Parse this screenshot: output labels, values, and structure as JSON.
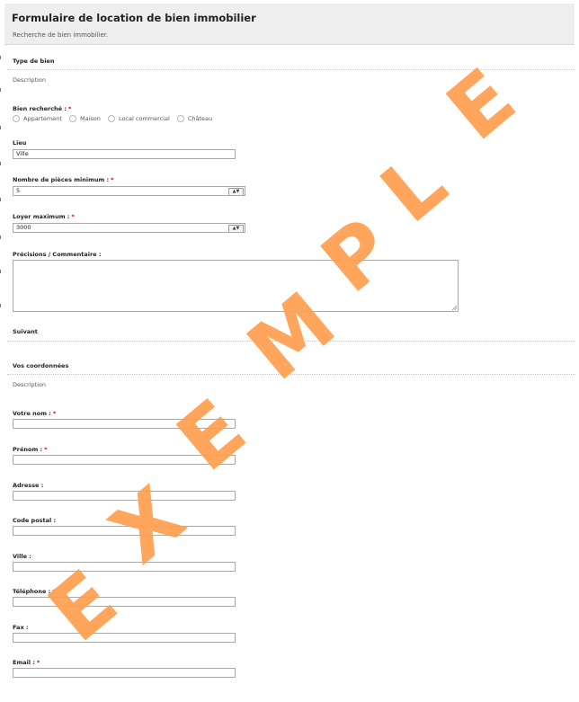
{
  "header": {
    "title": "Formulaire de location de bien immobilier",
    "subtitle": "Recherche de bien immobilier."
  },
  "section1": {
    "title": "Type de bien",
    "description": "Description",
    "bien_recherche": {
      "label": "Bien recherché :",
      "required": "*",
      "options": [
        "Appartement",
        "Maison",
        "Local commercial",
        "Château"
      ]
    },
    "lieu": {
      "label": "Lieu",
      "value": "Ville"
    },
    "pieces": {
      "label": "Nombre de pièces minimum :",
      "required": "*",
      "value": "5",
      "stepper": "▲▼"
    },
    "loyer": {
      "label": "Loyer maximum :",
      "required": "*",
      "value": "3000",
      "stepper": "▲▼"
    },
    "precisions": {
      "label": "Précisions / Commentaire :"
    },
    "next_label": "Suivant"
  },
  "section2": {
    "title": "Vos coordonnées",
    "description": "Description",
    "fields": [
      {
        "label": "Votre nom :",
        "required": "*"
      },
      {
        "label": "Prénom :",
        "required": "*"
      },
      {
        "label": "Adresse :",
        "required": ""
      },
      {
        "label": "Code postal :",
        "required": ""
      },
      {
        "label": "Ville :",
        "required": ""
      },
      {
        "label": "Téléphone :",
        "required": "*"
      },
      {
        "label": "Fax :",
        "required": ""
      },
      {
        "label": "Email :",
        "required": "*"
      }
    ]
  },
  "watermark": {
    "letters": [
      "E",
      "X",
      "E",
      "M",
      "P",
      "L",
      "E"
    ],
    "color": "#ff9f4f"
  }
}
